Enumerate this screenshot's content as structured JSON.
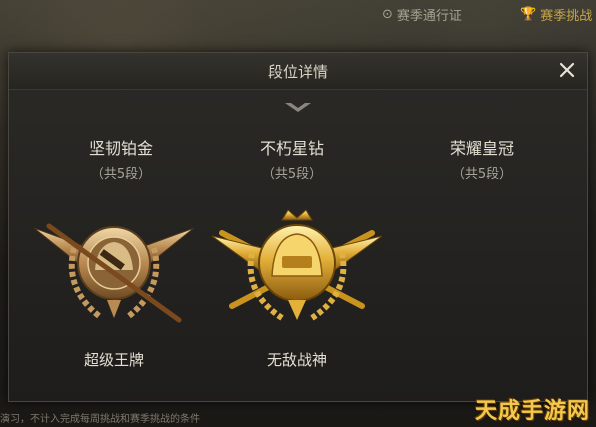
{
  "top_tabs": {
    "season_pass": "赛季通行证",
    "season_challenge": "赛季挑战"
  },
  "dialog": {
    "title": "段位详情",
    "ranks": [
      {
        "name": "坚韧铂金",
        "sub": "（共5段）"
      },
      {
        "name": "不朽星钻",
        "sub": "（共5段）"
      },
      {
        "name": "荣耀皇冠",
        "sub": "（共5段）"
      }
    ],
    "badges": [
      {
        "label": "超级王牌",
        "icon": "ace-badge-icon"
      },
      {
        "label": "无敌战神",
        "icon": "conqueror-badge-icon"
      }
    ]
  },
  "bottom_note": "演习，不计入完成每周挑战和赛季挑战的条件",
  "watermark": "天成手游网",
  "colors": {
    "gold": "#d9a93a",
    "bronze": "#b98a52",
    "accent": "#c6a64a"
  }
}
